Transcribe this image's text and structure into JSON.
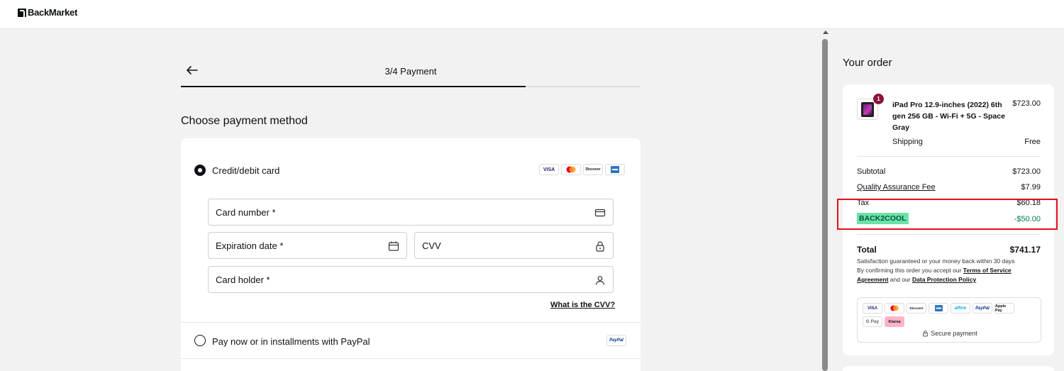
{
  "header": {
    "logo_text": "BackMarket"
  },
  "checkout": {
    "step_title": "3/4 Payment",
    "section_title": "Choose payment method",
    "card_option_label": "Credit/debit card",
    "card_brands": [
      "VISA",
      "MC",
      "Discover",
      "AMEX"
    ],
    "fields": {
      "card_number": "Card number *",
      "expiration_date": "Expiration date *",
      "cvv": "CVV",
      "card_holder": "Card holder *"
    },
    "cvv_help_link": "What is the CVV?",
    "paypal_option_label": "Pay now or in installments with PayPal",
    "paypal_logo": "PayPal",
    "progress_fraction": 0.75
  },
  "order": {
    "title": "Your order",
    "product": {
      "name": "iPad Pro 12.9-inches (2022) 6th gen 256 GB - Wi-Fi + 5G - Space Gray",
      "price": "$723.00",
      "quantity": "1"
    },
    "shipping_label": "Shipping",
    "shipping_value": "Free",
    "subtotal_label": "Subtotal",
    "subtotal_value": "$723.00",
    "quality_fee_label": "Quality Assurance Fee",
    "quality_fee_value": "$7.99",
    "tax_label": "Tax",
    "tax_value": "$60.18",
    "promo_code": "BACK2COOL",
    "promo_value": "-$50.00",
    "total_label": "Total",
    "total_value": "$741.17",
    "guarantee_text": "Satisfaction guaranteed or your money back within 30 days",
    "confirm_prefix": "By confirming this order you accept our",
    "terms_link": "Terms of Service Agreement",
    "confirm_mid": "and our",
    "privacy_link": "Data Protection Policy",
    "payment_methods_row1": [
      "VISA",
      "MC",
      "Discover",
      "AMEX",
      "affirm",
      "PayPal",
      "Apple Pay"
    ],
    "payment_methods_row2": [
      "G Pay",
      "Klarna"
    ],
    "secure_payment": "Secure payment"
  },
  "colors": {
    "promo_bg": "#6de2a8",
    "promo_text": "#00563f",
    "discount_text": "#00794b",
    "badge": "#8b1538",
    "highlight": "#e1111a"
  }
}
